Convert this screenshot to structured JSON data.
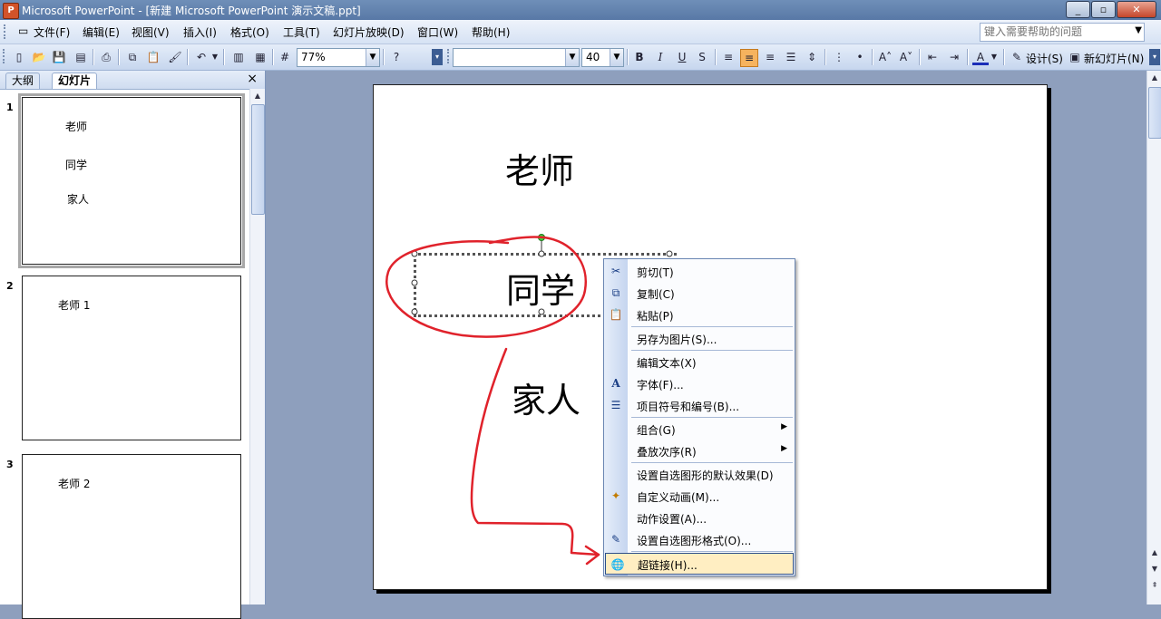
{
  "window": {
    "title": "Microsoft PowerPoint - [新建 Microsoft PowerPoint 演示文稿.ppt]",
    "app_icon": "P"
  },
  "menu": {
    "items": [
      "文件(F)",
      "编辑(E)",
      "视图(V)",
      "插入(I)",
      "格式(O)",
      "工具(T)",
      "幻灯片放映(D)",
      "窗口(W)",
      "帮助(H)"
    ],
    "help_placeholder": "键入需要帮助的问题"
  },
  "toolbar": {
    "zoom": "77%",
    "font_name": "",
    "font_size": "40",
    "bold": "B",
    "italic": "I",
    "underline": "U",
    "shadow": "S",
    "design_label": "设计(S)",
    "new_slide_label": "新幻灯片(N)"
  },
  "left_pane": {
    "tabs": [
      "大纲",
      "幻灯片"
    ],
    "close": "×",
    "slides": [
      {
        "number": "1",
        "lines": [
          "老师",
          "同学",
          "家人"
        ]
      },
      {
        "number": "2",
        "lines": [
          "老师 1"
        ]
      },
      {
        "number": "3",
        "lines": [
          "老师 2"
        ]
      }
    ]
  },
  "slide": {
    "texts": [
      "老师",
      "同学",
      "家人"
    ]
  },
  "context_menu": {
    "items": [
      {
        "icon": "cut-icon",
        "label": "剪切(T)"
      },
      {
        "icon": "copy-icon",
        "label": "复制(C)"
      },
      {
        "icon": "paste-icon",
        "label": "粘贴(P)"
      },
      {
        "icon": "",
        "label": "另存为图片(S)..."
      },
      {
        "icon": "",
        "label": "编辑文本(X)"
      },
      {
        "icon": "font-icon",
        "label": "字体(F)..."
      },
      {
        "icon": "bullets-icon",
        "label": "项目符号和编号(B)..."
      },
      {
        "icon": "",
        "label": "组合(G)"
      },
      {
        "icon": "",
        "label": "叠放次序(R)"
      },
      {
        "icon": "",
        "label": "设置自选图形的默认效果(D)"
      },
      {
        "icon": "custom-animation-icon",
        "label": "自定义动画(M)..."
      },
      {
        "icon": "",
        "label": "动作设置(A)..."
      },
      {
        "icon": "format-shape-icon",
        "label": "设置自选图形格式(O)..."
      },
      {
        "icon": "hyperlink-icon",
        "label": "超链接(H)..."
      }
    ]
  },
  "annotation_color": "#e0222b",
  "accent_color": "#f6b35e"
}
